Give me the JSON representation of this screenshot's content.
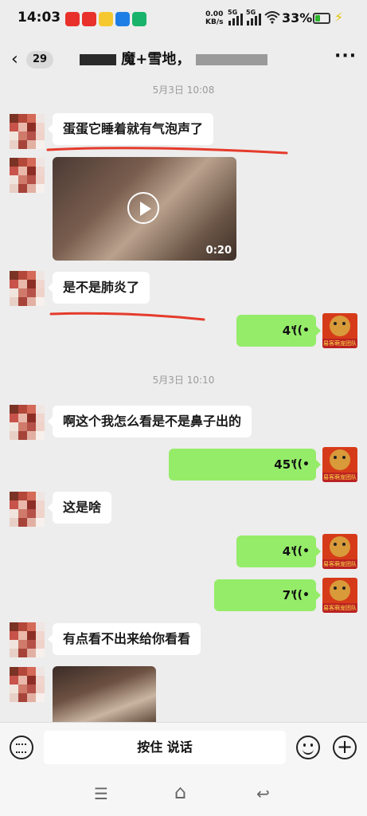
{
  "status": {
    "time": "14:03",
    "net_speed_value": "0.00",
    "net_speed_unit": "KB/s",
    "signal1_label": "5G",
    "signal2_label": "5G",
    "battery": "33%"
  },
  "header": {
    "back_label": "‹",
    "unread_count": "29",
    "title": "魔+雪地，",
    "more_label": "···"
  },
  "messages": {
    "ts1": "5月3日 10:08",
    "m1": "蛋蛋它睡着就有气泡声了",
    "video_duration": "0:20",
    "m2": "是不是肺炎了",
    "v1": "4\"",
    "ts2": "5月3日 10:10",
    "m3": "啊这个我怎么看是不是鼻子出的",
    "v2": "45\"",
    "m4": "这是啥",
    "v3": "4\"",
    "v4": "7\"",
    "m5": "有点看不出来给你看看"
  },
  "my_avatar_caption": "易客萌宠团队",
  "input": {
    "hold_to_talk": "按住 说话",
    "plus": "+"
  },
  "system_nav": {
    "menu": "☰",
    "home": "⌂",
    "back": "↩"
  },
  "colors": {
    "background": "#ededed",
    "my_bubble": "#95ec69",
    "their_bubble": "#ffffff",
    "annotation_red": "#e53b2c"
  }
}
